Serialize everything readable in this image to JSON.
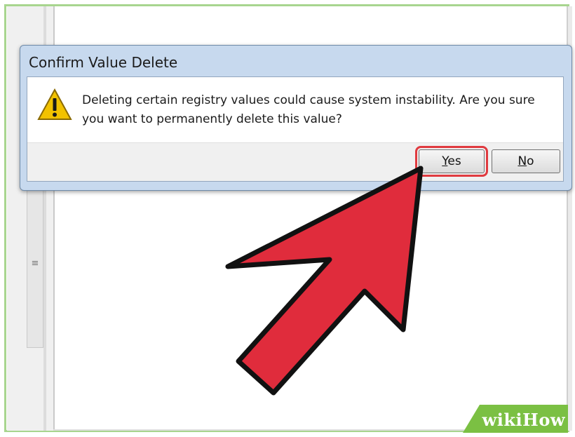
{
  "dialog": {
    "title": "Confirm Value Delete",
    "message": "Deleting certain registry values could cause system instability. Are you sure you want to permanently delete this value?",
    "yes_label_underlined": "Y",
    "yes_label_rest": "es",
    "no_label_underlined": "N",
    "no_label_rest": "o"
  },
  "watermark": {
    "prefix": "wiki",
    "brand": "How"
  },
  "colors": {
    "frame": "#a8d58f",
    "arrow_fill": "#e02c3c",
    "highlight": "#e03a3f"
  },
  "icons": {
    "warning": "warning-icon",
    "grip": "scroll-grip-icon",
    "pointer": "pointer-arrow-icon"
  }
}
